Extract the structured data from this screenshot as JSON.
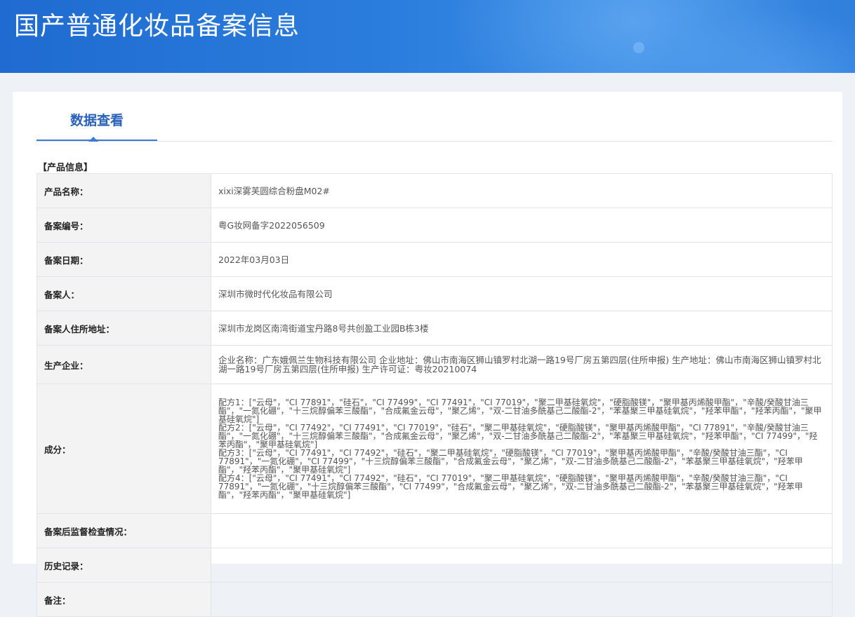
{
  "header": {
    "title": "国产普通化妆品备案信息"
  },
  "tabs": {
    "active": "数据查看"
  },
  "section": {
    "title": "【产品信息】"
  },
  "rows": [
    {
      "label": "产品名称：",
      "value": "xixi深雾芙圆综合粉盘M02#"
    },
    {
      "label": "备案编号：",
      "value": "粤G妆网备字2022056509"
    },
    {
      "label": "备案日期：",
      "value": "2022年03月03日"
    },
    {
      "label": "备案人：",
      "value": "深圳市微时代化妆品有限公司"
    },
    {
      "label": "备案人住所地址：",
      "value": "深圳市龙岗区南湾街道宝丹路8号共创盈工业园B栋3楼"
    },
    {
      "label": "生产企业：",
      "value": "企业名称：广东娥佩兰生物科技有限公司 企业地址：佛山市南海区狮山镇罗村北湖一路19号厂房五第四层(住所申报) 生产地址：佛山市南海区狮山镇罗村北湖一路19号厂房五第四层(住所申报) 生产许可证：粤妆20210074"
    },
    {
      "label": "成分：",
      "lines": [
        "配方1：[\"云母\"，\"CI 77891\"，\"硅石\"，\"CI 77499\"，\"CI 77491\"，\"CI 77019\"，\"聚二甲基硅氧烷\"，\"硬脂酸镁\"，\"聚甲基丙烯酸甲酯\"，\"辛酸/癸酸甘油三酯\"，\"一氮化硼\"，\"十三烷醇偏苯三酸酯\"，\"合成氟金云母\"，\"聚乙烯\"，\"双-二甘油多酰基己二酸酯-2\"，\"苯基聚三甲基硅氧烷\"，\"羟苯甲酯\"，\"羟苯丙酯\"，\"聚甲基硅氧烷\"]",
        "配方2：[\"云母\"，\"CI 77492\"，\"CI 77491\"，\"CI 77019\"，\"硅石\"，\"聚二甲基硅氧烷\"，\"硬脂酸镁\"，\"聚甲基丙烯酸甲酯\"，\"CI 77891\"，\"辛酸/癸酸甘油三酯\"，\"一氮化硼\"，\"十三烷醇偏苯三酸酯\"，\"合成氟金云母\"，\"聚乙烯\"，\"双-二甘油多酰基己二酸酯-2\"，\"苯基聚三甲基硅氧烷\"，\"羟苯甲酯\"，\"CI 77499\"，\"羟苯丙酯\"，\"聚甲基硅氧烷\"]",
        "配方3：[\"云母\"，\"CI 77491\"，\"CI 77492\"，\"硅石\"，\"聚二甲基硅氧烷\"，\"硬脂酸镁\"，\"CI 77019\"，\"聚甲基丙烯酸甲酯\"，\"辛酸/癸酸甘油三酯\"，\"CI 77891\"，\"一氮化硼\"，\"CI 77499\"，\"十三烷醇偏苯三酸酯\"，\"合成氟金云母\"，\"聚乙烯\"，\"双-二甘油多酰基己二酸酯-2\"，\"苯基聚三甲基硅氧烷\"，\"羟苯甲酯\"，\"羟苯丙酯\"，\"聚甲基硅氧烷\"]",
        "配方4：[\"云母\"，\"CI 77491\"，\"CI 77492\"，\"硅石\"，\"CI 77019\"，\"聚二甲基硅氧烷\"，\"硬脂酸镁\"，\"聚甲基丙烯酸甲酯\"，\"辛酸/癸酸甘油三酯\"，\"CI 77891\"，\"一氮化硼\"，\"十三烷醇偏苯三酸酯\"，\"CI 77499\"，\"合成氟金云母\"，\"聚乙烯\"，\"双-二甘油多酰基己二酸酯-2\"，\"苯基聚三甲基硅氧烷\"，\"羟苯甲酯\"，\"羟苯丙酯\"，\"聚甲基硅氧烷\"]"
      ]
    },
    {
      "label": "备案后监督检查情况：",
      "value": ""
    },
    {
      "label": "历史记录：",
      "value": ""
    },
    {
      "label": "备注：",
      "value": ""
    }
  ],
  "colors": {
    "banner": "#2b7ddd",
    "accent": "#2a62b8",
    "table_border": "#a9c6ea",
    "label_bg": "#f3f3f3"
  }
}
